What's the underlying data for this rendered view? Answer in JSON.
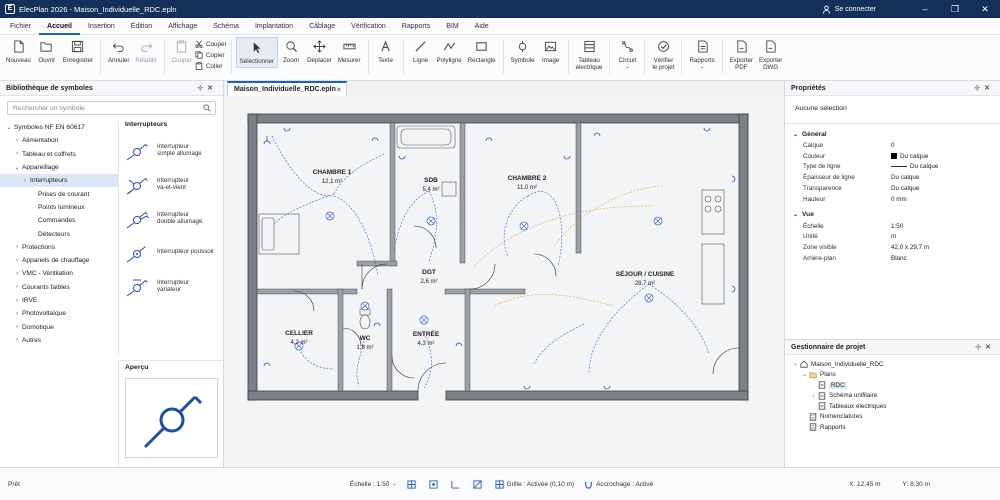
{
  "app": {
    "title": "ElecPlan 2026 - Maison_Individuelle_RDC.epln",
    "sign_in": "Se connecter"
  },
  "menu": [
    "Fichier",
    "Accueil",
    "Insertion",
    "Édition",
    "Affichage",
    "Schéma",
    "Implantation",
    "Câblage",
    "Vérification",
    "Rapports",
    "BIM",
    "Aide"
  ],
  "menu_active": "Accueil",
  "ribbon": {
    "nouveau": "Nouveau",
    "ouvrir": "Ouvrir",
    "enregistrer": "Enregistrer",
    "annuler": "Annuler",
    "retablir": "Rétablir",
    "couper_big": "Couper",
    "couper": "Couper",
    "copier": "Copier",
    "coller": "Coller",
    "selectionner": "Sélectionner",
    "zoom": "Zoom",
    "deplacer": "Déplacer",
    "mesurer": "Mesurer",
    "texte": "Texte",
    "ligne": "Ligne",
    "polyligne": "Polyligne",
    "rectangle": "Rectangle",
    "symbole": "Symbole",
    "image": "Image",
    "tableau1": "Tableau",
    "tableau2": "électrique",
    "circuit": "Circuit",
    "verifier1": "Vérifier",
    "verifier2": "le projet",
    "rapports": "Rapports",
    "exp_pdf1": "Exporter",
    "exp_pdf2": "PDF",
    "exp_dwg1": "Exporter",
    "exp_dwg2": "DWG"
  },
  "library": {
    "title": "Bibliothèque de symboles",
    "search_placeholder": "Rechercher un symbole",
    "root": "Symboles NF EN 60617",
    "items": [
      {
        "label": "Alimentation",
        "level": 1,
        "chevron": "›"
      },
      {
        "label": "Tableau et coffrets",
        "level": 1,
        "chevron": "›"
      },
      {
        "label": "Appareillage",
        "level": 1,
        "chevron": "⌄"
      },
      {
        "label": "Interrupteurs",
        "level": 2,
        "chevron": "›",
        "selected": true
      },
      {
        "label": "Prises de courant",
        "level": 3,
        "chevron": ""
      },
      {
        "label": "Points lumineux",
        "level": 3,
        "chevron": ""
      },
      {
        "label": "Commandes",
        "level": 3,
        "chevron": ""
      },
      {
        "label": "Détecteurs",
        "level": 3,
        "chevron": ""
      },
      {
        "label": "Protections",
        "level": 1,
        "chevron": "›"
      },
      {
        "label": "Appareils de chauffage",
        "level": 1,
        "chevron": "›"
      },
      {
        "label": "VMC - Ventilation",
        "level": 1,
        "chevron": "›"
      },
      {
        "label": "Courants faibles",
        "level": 1,
        "chevron": "›"
      },
      {
        "label": "IRVE",
        "level": 1,
        "chevron": "›"
      },
      {
        "label": "Photovoltaïque",
        "level": 1,
        "chevron": "›"
      },
      {
        "label": "Domotique",
        "level": 1,
        "chevron": "›"
      },
      {
        "label": "Autres",
        "level": 1,
        "chevron": "›"
      }
    ],
    "category": "Interrupteurs",
    "symbols": [
      {
        "l1": "Interrupteur",
        "l2": "simple allumage"
      },
      {
        "l1": "Interrupteur",
        "l2": "va-et-vient"
      },
      {
        "l1": "Interrupteur",
        "l2": "double allumage"
      },
      {
        "l1": "Interrupteur poussoir",
        "l2": ""
      },
      {
        "l1": "Interrupteur",
        "l2": "variateur"
      }
    ],
    "preview_title": "Aperçu"
  },
  "document": {
    "tab": "Maison_Individuelle_RDC.epln",
    "rooms": [
      {
        "name": "CHAMBRE 1",
        "area": "12,1 m²"
      },
      {
        "name": "SDB",
        "area": "5,4 m²"
      },
      {
        "name": "CHAMBRE 2",
        "area": "11,0 m²"
      },
      {
        "name": "SÉJOUR / CUISINE",
        "area": "28,7 m²"
      },
      {
        "name": "DGT",
        "area": "2,6 m²"
      },
      {
        "name": "CELLIER",
        "area": "4,2 m²"
      },
      {
        "name": "WC",
        "area": "1,8 m²"
      },
      {
        "name": "ENTRÉE",
        "area": "4,3 m²"
      }
    ]
  },
  "properties": {
    "title": "Propriétés",
    "no_selection": "Aucune sélection",
    "general_title": "Général",
    "general": [
      {
        "k": "Calque",
        "v": "0"
      },
      {
        "k": "Couleur",
        "v": "Du calque",
        "swatch": "#000000"
      },
      {
        "k": "Type de ligne",
        "v": "Du calque",
        "line": true
      },
      {
        "k": "Épaisseur de ligne",
        "v": "Du calque"
      },
      {
        "k": "Transparence",
        "v": "Du calque"
      },
      {
        "k": "Hauteur",
        "v": "0 mm"
      }
    ],
    "view_title": "Vue",
    "view": [
      {
        "k": "Échelle",
        "v": "1:50"
      },
      {
        "k": "Unité",
        "v": "m"
      },
      {
        "k": "Zone visible",
        "v": "42,0 x 29,7 m"
      },
      {
        "k": "Arrière-plan",
        "v": "Blanc"
      }
    ]
  },
  "project": {
    "title": "Gestionnaire de projet",
    "nodes": [
      {
        "label": "Maison_Individuelle_RDC",
        "level": 0,
        "chevron": "⌄",
        "icon": "house-icon"
      },
      {
        "label": "Plans",
        "level": 1,
        "chevron": "⌄",
        "icon": "folder-icon"
      },
      {
        "label": "RDC",
        "level": 2,
        "chevron": "",
        "icon": "plan-icon",
        "selected": true
      },
      {
        "label": "Schéma unifilaire",
        "level": 2,
        "chevron": "›",
        "icon": "plan-icon"
      },
      {
        "label": "Tableaux électriques",
        "level": 2,
        "chevron": "",
        "icon": "plan-icon"
      },
      {
        "label": "Nomenclatures",
        "level": 1,
        "chevron": "",
        "icon": "list-icon"
      },
      {
        "label": "Rapports",
        "level": 1,
        "chevron": "",
        "icon": "list-icon"
      }
    ]
  },
  "status": {
    "ready": "Prêt",
    "scale": "Échelle : 1:50",
    "grid": "Grille : Activée (0,10 m)",
    "snap": "Accrochage : Activé",
    "x": "X: 12,45 m",
    "y": "Y: 8,30 m"
  },
  "colors": {
    "titlebar": "#12305a",
    "accent": "#1d5fc4",
    "wiring_blue": "#3a5fcf",
    "wiring_orange": "#e7a33c"
  }
}
